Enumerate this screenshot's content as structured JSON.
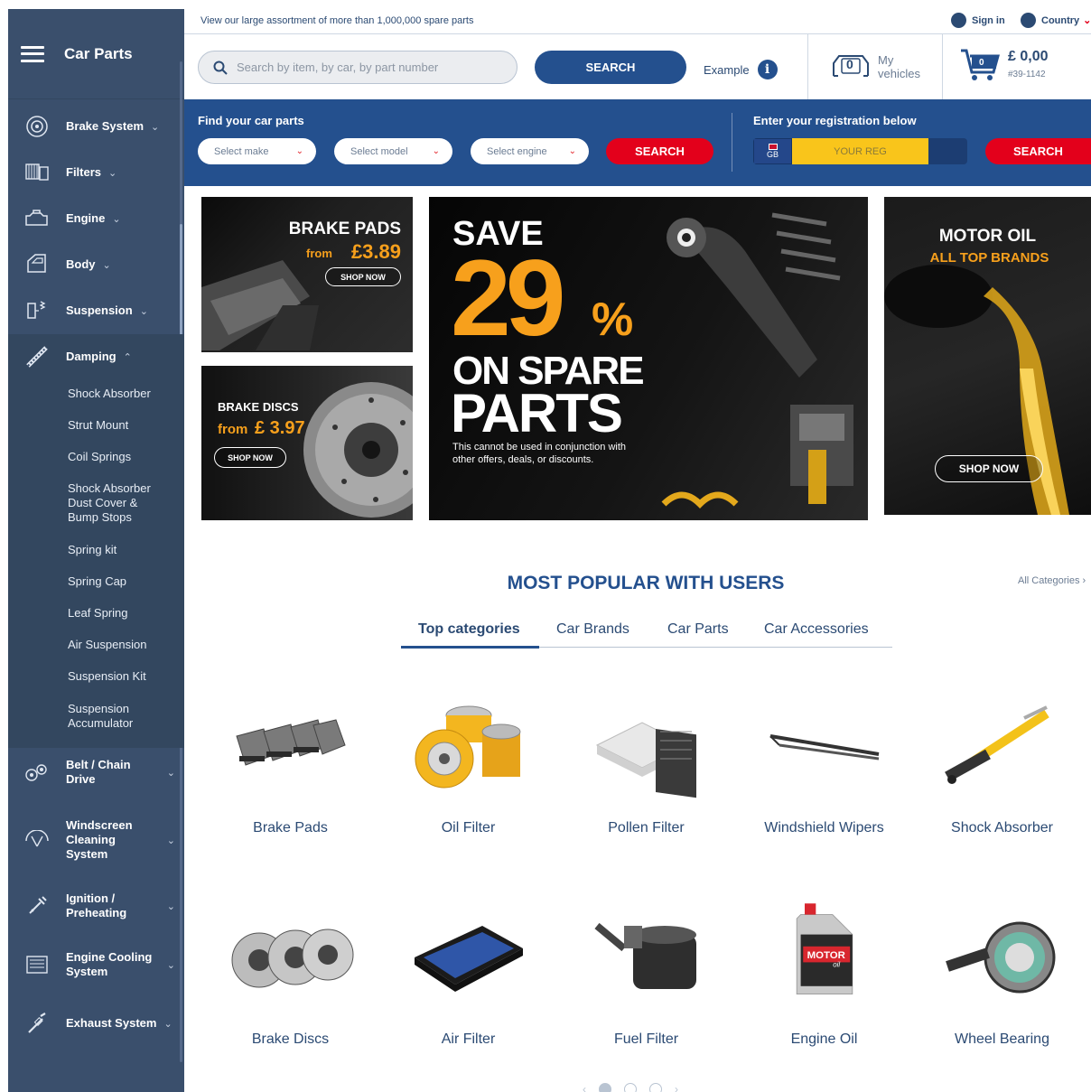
{
  "topbar": {
    "message": "View our large assortment of more than 1,000,000 spare parts",
    "signin": "Sign in",
    "country": "Country"
  },
  "sidebar": {
    "title": "Car Parts",
    "categories": [
      {
        "label": "Brake System",
        "icon": "brake-disc-icon"
      },
      {
        "label": "Filters",
        "icon": "filter-icon"
      },
      {
        "label": "Engine",
        "icon": "engine-icon"
      },
      {
        "label": "Body",
        "icon": "car-body-icon"
      },
      {
        "label": "Suspension",
        "icon": "suspension-icon"
      },
      {
        "label": "Damping",
        "icon": "shock-absorber-icon"
      },
      {
        "label": "Belt / Chain Drive",
        "icon": "belt-icon"
      },
      {
        "label": "Windscreen Cleaning System",
        "icon": "wiper-icon"
      },
      {
        "label": "Ignition / Preheating",
        "icon": "spark-plug-icon"
      },
      {
        "label": "Engine Cooling System",
        "icon": "radiator-icon"
      },
      {
        "label": "Exhaust System",
        "icon": "exhaust-icon"
      }
    ],
    "damping_items": [
      "Shock Absorber",
      "Strut Mount",
      "Coil Springs",
      "Shock Absorber Dust Cover & Bump Stops",
      "Spring kit",
      "Spring Cap",
      "Leaf Spring",
      "Air Suspension",
      "Suspension Kit",
      "Suspension Accumulator"
    ]
  },
  "header": {
    "search_placeholder": "Search by item, by car, by part number",
    "search_button": "SEARCH",
    "example": "Example",
    "my_vehicles_count": "0",
    "my_vehicles_line1": "My",
    "my_vehicles_line2": "vehicles",
    "cart_count": "0",
    "cart_amount": "£ 0,00",
    "cart_number": "#39-1142"
  },
  "finder": {
    "title": "Find your car parts",
    "make": "Select make",
    "model": "Select model",
    "engine": "Select engine",
    "search": "SEARCH",
    "reg_title": "Enter your registration below",
    "reg_country": "GB",
    "reg_placeholder": "YOUR REG",
    "reg_search": "SEARCH"
  },
  "banners": {
    "brake_pads": {
      "title": "BRAKE PADS",
      "from": "from",
      "price": "£3.89",
      "cta": "SHOP NOW"
    },
    "brake_discs": {
      "title": "BRAKE DISCS",
      "from": "from",
      "price": "£ 3.97",
      "cta": "SHOP NOW"
    },
    "save": {
      "line1": "SAVE",
      "num": "29",
      "pct": "%",
      "line2": "ON SPARE",
      "line3": "PARTS",
      "note": "This cannot be used in conjunction with other offers, deals, or discounts."
    },
    "motor_oil": {
      "title": "MOTOR OIL",
      "subtitle": "ALL TOP BRANDS",
      "cta": "SHOP NOW"
    }
  },
  "popular": {
    "title": "MOST POPULAR WITH USERS",
    "all_categories": "All Categories",
    "tabs": [
      "Top categories",
      "Car Brands",
      "Car Parts",
      "Car Accessories"
    ],
    "products": [
      "Brake Pads",
      "Oil Filter",
      "Pollen Filter",
      "Windshield Wipers",
      "Shock Absorber",
      "Brake Discs",
      "Air Filter",
      "Fuel Filter",
      "Engine Oil",
      "Wheel Bearing"
    ],
    "engine_oil_brand": "MOTOR",
    "engine_oil_sub": "oil"
  },
  "colors": {
    "navy": "#24508e",
    "sidebar": "#3a4f6c",
    "red": "#e3001b",
    "orange": "#f7a01c",
    "yellow": "#f9c51b"
  }
}
